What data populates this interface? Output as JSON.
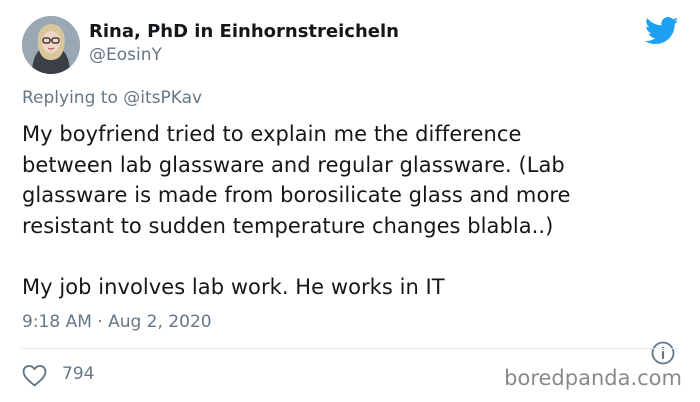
{
  "author": {
    "display_name": "Rina, PhD in Einhornstreicheln",
    "handle": "@EosinY"
  },
  "reply": {
    "prefix": "Replying to ",
    "mention": "@itsPKav"
  },
  "tweet": {
    "lines": [
      "My boyfriend tried to explain me the difference",
      "between lab glassware and regular glassware. (Lab",
      "glassware is made from borosilicate glass and more",
      "resistant to sudden temperature changes blabla..)",
      "My job involves lab work. He works in IT"
    ],
    "timestamp": "9:18 AM · Aug 2, 2020"
  },
  "engagement": {
    "likes": "794"
  },
  "watermark": "boredpanda.com",
  "icons": {
    "brand": "twitter-bird-icon",
    "info": "info-icon",
    "like": "heart-icon"
  },
  "colors": {
    "twitter_blue": "#1da1f2",
    "text_primary": "#14171a",
    "text_secondary": "#657786",
    "divider": "#e1e8ed"
  }
}
